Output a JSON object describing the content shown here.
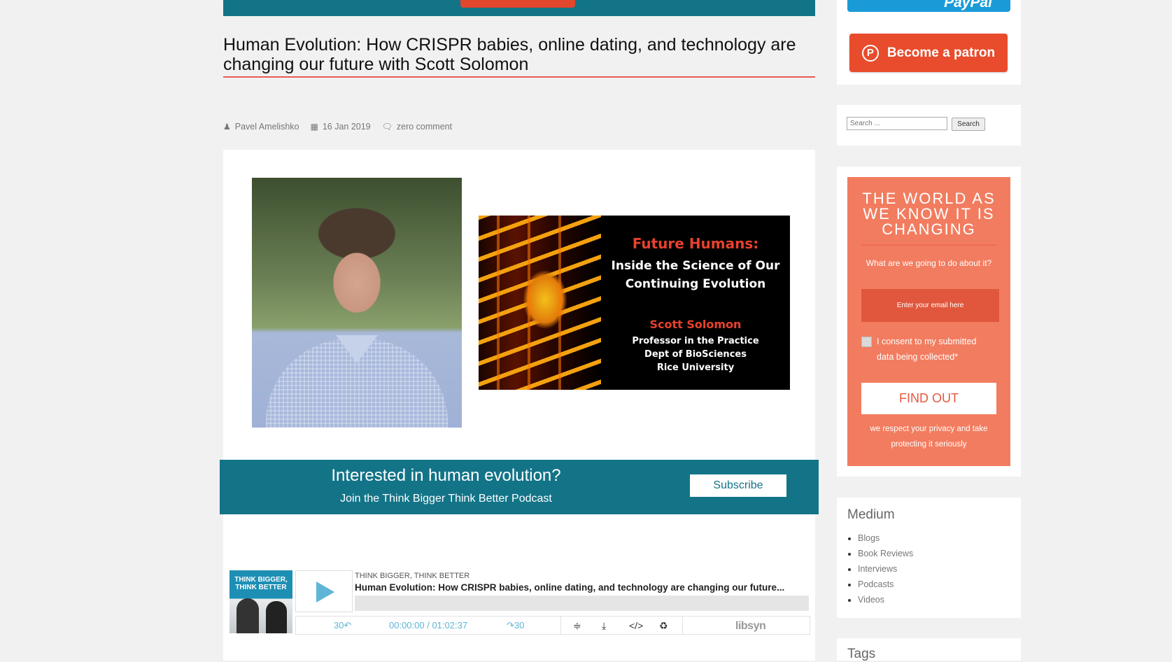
{
  "paypal": {
    "label": "PayPal"
  },
  "patron": {
    "label": "Become a patron"
  },
  "post": {
    "title": "Human Evolution: How CRISPR babies, online dating, and technology are changing our future with Scott Solomon",
    "author": "Pavel Amelishko",
    "date": "16 Jan 2019",
    "comments": "zero comment"
  },
  "book_cover": {
    "title": "Future Humans:",
    "subtitle": "Inside the Science of Our\nContinuing Evolution",
    "author": "Scott Solomon",
    "affiliation": "Professor in the Practice\nDept of BioSciences\nRice University"
  },
  "subscribe_banner": {
    "question": "Interested in human evolution?",
    "subtitle": "Join the Think Bigger Think Better Podcast",
    "button": "Subscribe"
  },
  "player": {
    "art_text": "THINK BIGGER,\nTHINK BETTER",
    "show": "THINK BIGGER, THINK BETTER",
    "episode": "Human Evolution: How CRISPR babies, online dating, and technology are changing our future...",
    "back": "30↶",
    "time": "00:00:00 / 01:02:37",
    "forward": "↷30",
    "brand": "libsyn",
    "progress": 0
  },
  "search": {
    "placeholder": "Search ...",
    "button": "Search"
  },
  "optin": {
    "heading": "THE WORLD AS\nWE KNOW IT IS\nCHANGING",
    "subheading": "What are we going to do about it?",
    "email_placeholder": "Enter your email here",
    "consent": "I consent to my submitted data being collected*",
    "button": "FIND OUT",
    "privacy": "we respect your privacy and take protecting it seriously"
  },
  "medium": {
    "title": "Medium",
    "items": [
      "Blogs",
      "Book Reviews",
      "Interviews",
      "Podcasts",
      "Videos"
    ]
  },
  "tags": {
    "title": "Tags"
  },
  "colors": {
    "teal": "#137488",
    "optin": "#f27c5f",
    "patron": "#e84c2c",
    "title_rule": "#e45b5b"
  }
}
